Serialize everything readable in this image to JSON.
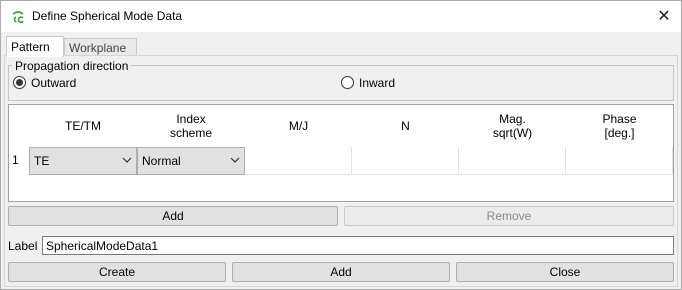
{
  "window": {
    "title": "Define Spherical Mode Data",
    "app_icon": "cst-logo-icon",
    "close_icon": "close-icon",
    "close_glyph": "✕"
  },
  "tabs": [
    {
      "label": "Pattern",
      "active": true
    },
    {
      "label": "Workplane",
      "active": false
    }
  ],
  "propagation": {
    "group_label": "Propagation direction",
    "options": [
      {
        "label": "Outward",
        "checked": true
      },
      {
        "label": "Inward",
        "checked": false
      }
    ]
  },
  "table": {
    "headers": [
      "TE/TM",
      "Index\nscheme",
      "M/J",
      "N",
      "Mag.\nsqrt(W)",
      "Phase\n[deg.]"
    ],
    "rows": [
      {
        "num": "1",
        "te_tm": "TE",
        "index_scheme": "Normal",
        "mj": "",
        "n": "",
        "mag": "",
        "phase": ""
      }
    ]
  },
  "table_buttons": {
    "add": "Add",
    "remove": "Remove"
  },
  "label_field": {
    "caption": "Label",
    "value": "SphericalModeData1"
  },
  "footer": {
    "create": "Create",
    "add": "Add",
    "close": "Close"
  },
  "colors": {
    "accent_icon": "#3aa645",
    "button_bg": "#e1e1e1"
  }
}
